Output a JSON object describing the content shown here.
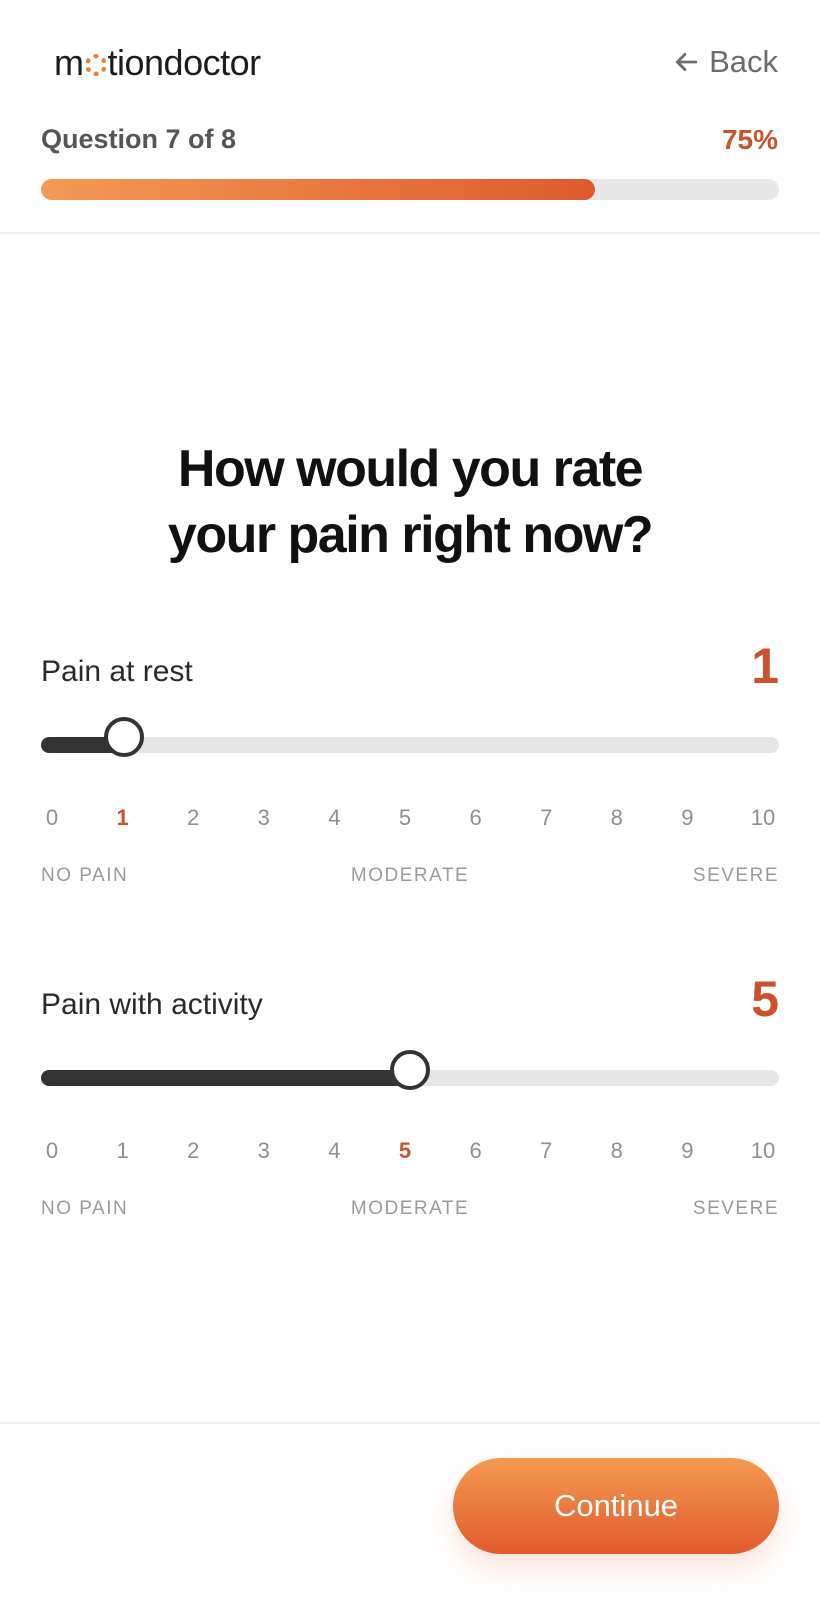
{
  "header": {
    "logo_left": "m",
    "logo_right": "tiondoctor",
    "logo_full": "motiondoctor",
    "back_label": "Back",
    "back_icon": "arrow-left-icon",
    "question_label": "Question 7 of 8",
    "progress_percent_label": "75%",
    "progress_value": 0.75
  },
  "main": {
    "title_line1": "How would you rate",
    "title_line2": "your pain right now?",
    "scales": [
      {
        "label": "Pain at rest",
        "value": 1,
        "value_text": "1",
        "min": 0,
        "max": 10,
        "ticks": [
          "0",
          "1",
          "2",
          "3",
          "4",
          "5",
          "6",
          "7",
          "8",
          "9",
          "10"
        ],
        "anchor_low": "NO PAIN",
        "anchor_mid": "MODERATE",
        "anchor_high": "SEVERE"
      },
      {
        "label": "Pain with activity",
        "value": 5,
        "value_text": "5",
        "min": 0,
        "max": 10,
        "ticks": [
          "0",
          "1",
          "2",
          "3",
          "4",
          "5",
          "6",
          "7",
          "8",
          "9",
          "10"
        ],
        "anchor_low": "NO PAIN",
        "anchor_mid": "MODERATE",
        "anchor_high": "SEVERE"
      }
    ]
  },
  "footer": {
    "continue_label": "Continue"
  },
  "colors": {
    "accent": "#c8532d",
    "gradient_start": "#f29a53",
    "gradient_end": "#df5a2e",
    "slider_fill": "#333333",
    "track": "#e5e5e5"
  }
}
